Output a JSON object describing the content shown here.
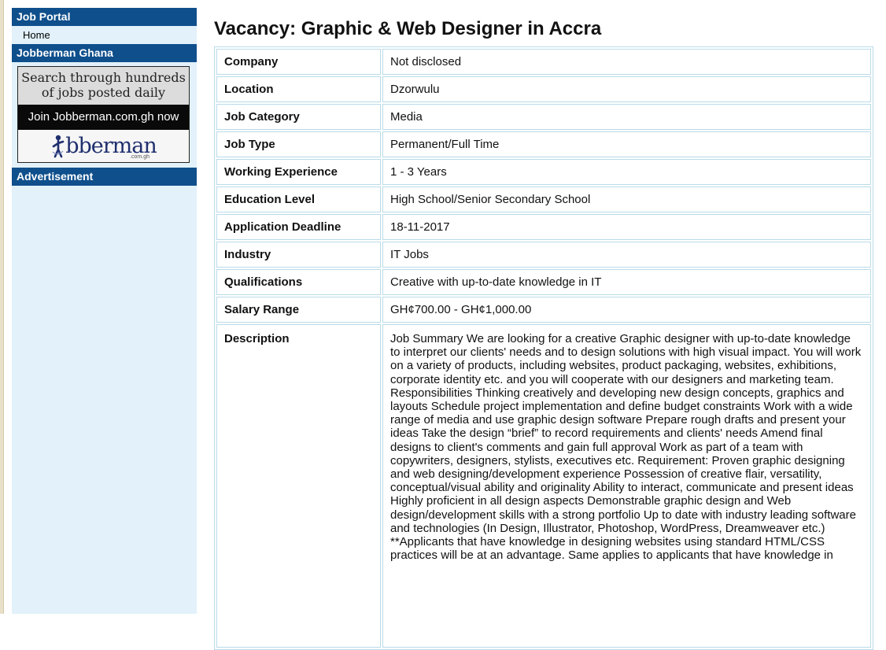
{
  "sidebar": {
    "portal_header": "Job Portal",
    "home_link": "Home",
    "jobberman_header": "Jobberman Ghana",
    "banner": {
      "top_text": "Search through hundreds of jobs posted daily",
      "middle_text": "Join Jobberman.com.gh now",
      "logo_text": "bberman",
      "logo_sub": ".com.gh"
    },
    "ad_header": "Advertisement"
  },
  "page_title": "Vacancy: Graphic & Web Designer in Accra",
  "details": [
    {
      "label": "Company",
      "value": "Not disclosed"
    },
    {
      "label": "Location",
      "value": "Dzorwulu"
    },
    {
      "label": "Job Category",
      "value": "Media"
    },
    {
      "label": "Job Type",
      "value": "Permanent/Full Time"
    },
    {
      "label": "Working Experience",
      "value": "1 - 3 Years"
    },
    {
      "label": "Education Level",
      "value": "High School/Senior Secondary School"
    },
    {
      "label": "Application Deadline",
      "value": "18-11-2017"
    },
    {
      "label": "Industry",
      "value": "IT Jobs"
    },
    {
      "label": "Qualifications",
      "value": "Creative with up-to-date knowledge in IT"
    },
    {
      "label": "Salary Range",
      "value": "GH¢700.00 - GH¢1,000.00"
    }
  ],
  "description": {
    "label": "Description",
    "text": "Job Summary We are looking for a creative Graphic designer with up-to-date knowledge to interpret our clients' needs and to design solutions with high visual impact. You will work on a variety of products, including websites, product packaging, websites, exhibitions, corporate identity etc. and you will cooperate with our designers and marketing team. Responsibilities Thinking creatively and developing new design concepts, graphics and layouts Schedule project implementation and define budget constraints Work with a wide range of media and use graphic design software Prepare rough drafts and present your ideas Take the design “brief” to record requirements and clients' needs Amend final designs to client's comments and gain full approval Work as part of a team with copywriters, designers, stylists, executives etc. Requirement: Proven graphic designing and web designing/development experience Possession of creative flair, versatility, conceptual/visual ability and originality Ability to interact, communicate and present ideas Highly proficient in all design aspects Demonstrable graphic design and Web design/development skills with a strong portfolio Up to date with industry leading software and technologies (In Design, Illustrator, Photoshop, WordPress, Dreamweaver etc.) **Applicants that have knowledge in designing websites using standard HTML/CSS practices will be at an advantage. Same applies to applicants that have knowledge in"
  },
  "colors": {
    "header_blue": "#0f4f8c",
    "sidebar_bg": "#e2f1fa",
    "table_border": "#b9dbe9"
  }
}
